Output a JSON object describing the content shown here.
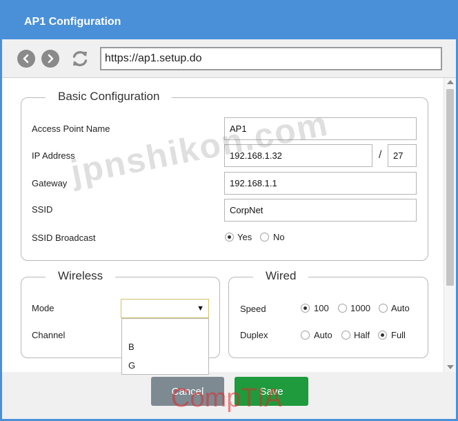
{
  "window": {
    "title": "AP1 Configuration"
  },
  "browser": {
    "url": "https://ap1.setup.do"
  },
  "basic": {
    "legend": "Basic Configuration",
    "ap_name_label": "Access Point Name",
    "ap_name_value": "AP1",
    "ip_label": "IP Address",
    "ip_value": "192.168.1.32",
    "ip_slash": "/",
    "ip_mask": "27",
    "gateway_label": "Gateway",
    "gateway_value": "192.168.1.1",
    "ssid_label": "SSID",
    "ssid_value": "CorpNet",
    "ssid_broadcast_label": "SSID Broadcast",
    "ssid_broadcast_options": [
      "Yes",
      "No"
    ],
    "ssid_broadcast_selected": "Yes"
  },
  "wireless": {
    "legend": "Wireless",
    "mode_label": "Mode",
    "mode_value": "",
    "mode_options": [
      "B",
      "G"
    ],
    "channel_label": "Channel"
  },
  "wired": {
    "legend": "Wired",
    "speed_label": "Speed",
    "speed_options": [
      "100",
      "1000",
      "Auto"
    ],
    "speed_selected": "100",
    "duplex_label": "Duplex",
    "duplex_options": [
      "Auto",
      "Half",
      "Full"
    ],
    "duplex_selected": "Full"
  },
  "footer": {
    "cancel_label": "Cancel",
    "save_label": "Save"
  },
  "overlay": {
    "watermark": "jpnshikon.com",
    "brand": "CompTIA"
  },
  "colors": {
    "titlebar": "#4a90d9",
    "cancel": "#7d8a92",
    "save": "#1f9a3d",
    "brand": "#e12828"
  }
}
